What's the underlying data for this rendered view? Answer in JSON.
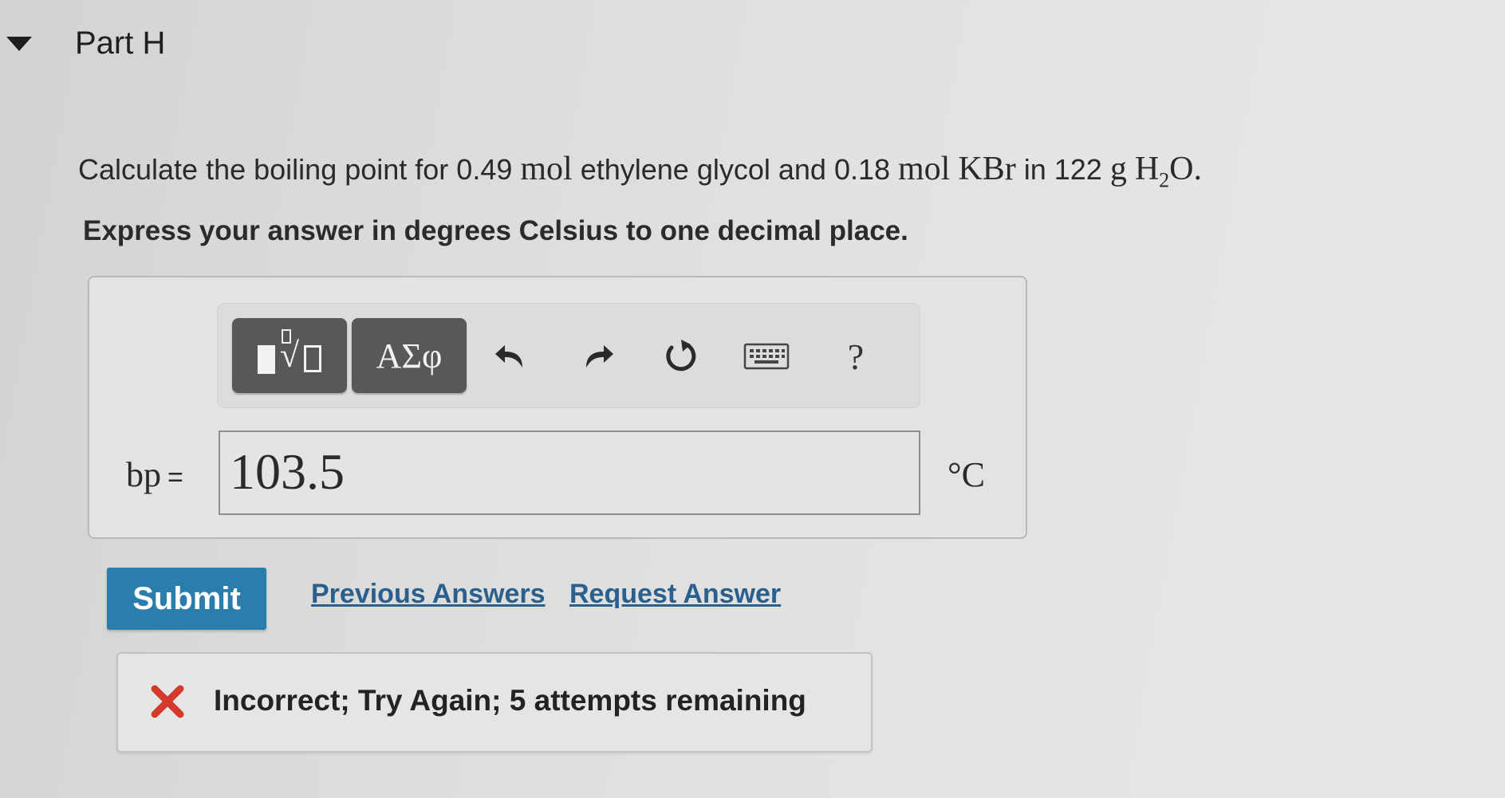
{
  "part": {
    "title": "Part H"
  },
  "question": {
    "text_1": "Calculate the boiling point for 0.49 ",
    "unit_mol_1": "mol",
    "text_2": " ethylene glycol and 0.18 ",
    "unit_mol_2": "mol",
    "compound": "KBr",
    "text_3": " in 122 ",
    "unit_g": "g",
    "water_h": "H",
    "water_sub": "2",
    "water_o": "O",
    "period": ".",
    "instruction": "Express your answer in degrees Celsius to one decimal place."
  },
  "toolbar": {
    "symbols_label": "ΑΣφ",
    "help_label": "?"
  },
  "answer": {
    "variable": "bp",
    "equals": "=",
    "value": "103.5",
    "unit": "°C"
  },
  "actions": {
    "submit_label": "Submit",
    "previous_answers_label": "Previous Answers",
    "request_answer_label": "Request Answer"
  },
  "feedback": {
    "message": "Incorrect; Try Again; 5 attempts remaining"
  },
  "colors": {
    "submit": "#2b7eab",
    "link": "#2a5f8e",
    "error": "#d33a2c"
  },
  "icons": {
    "toggle": "triangle-down-icon",
    "templates": "templates-icon",
    "undo": "undo-icon",
    "redo": "redo-icon",
    "reset": "reset-icon",
    "keyboard": "keyboard-icon",
    "help": "help-icon",
    "incorrect": "x-mark-icon"
  }
}
